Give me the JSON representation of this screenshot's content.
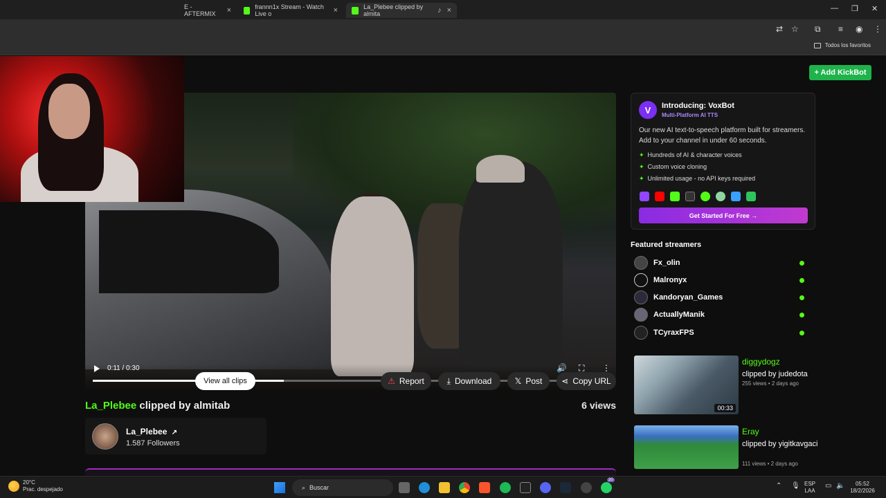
{
  "browser": {
    "tabs": [
      {
        "title": "E - AFTERMIX",
        "active": false
      },
      {
        "title": "frannn1x Stream - Watch Live o",
        "active": false
      },
      {
        "title": "La_Plebee clipped by almita",
        "active": true
      }
    ],
    "bookmarks_folder": "Todos los favoritos"
  },
  "header": {
    "add_bot_label": "+ Add KickBot"
  },
  "player": {
    "time": "0:11 / 0:30",
    "progress": 0.37
  },
  "clip": {
    "channel": "La_Plebee",
    "clipped_by": " clipped by almitab",
    "views": "6 views"
  },
  "channel_card": {
    "name": "La_Plebee",
    "followers": "1.587 Followers",
    "view_all_label": "View all clips"
  },
  "actions": {
    "report": "Report",
    "download": "Download",
    "post": "Post",
    "copy_url": "Copy URL"
  },
  "promo": {
    "title": "Introducing: VoxBot",
    "subtitle": "Multi-Platform AI TTS",
    "description": "Our new AI text-to-speech platform built for streamers. Add to your channel in under 60 seconds.",
    "features": [
      "Hundreds of AI & character voices",
      "Custom voice cloning",
      "Unlimited usage - no API keys required"
    ],
    "cta": "Get Started For Free →"
  },
  "featured": {
    "heading": "Featured streamers",
    "streamers": [
      "Fx_olin",
      "Malronyx",
      "Kandoryan_Games",
      "ActuallyManik",
      "TCyraxFPS"
    ]
  },
  "clips": [
    {
      "channel": "diggydogz",
      "clipped_by": "clipped by judedota",
      "meta": "255 views • 2 days ago",
      "duration": "00:33"
    },
    {
      "channel": "Eray",
      "clipped_by": "clipped by yigitkavgaci",
      "meta": "111 views • 2 days ago",
      "duration": ""
    }
  ],
  "taskbar": {
    "temp": "20°C",
    "weather": "Prac. despejado",
    "search": "Buscar",
    "lang1": "ESP",
    "lang2": "LAA",
    "time": "05:52",
    "date": "18/2/2026",
    "badge": "20"
  },
  "colors": {
    "kick_green": "#53fc18",
    "accent_purple": "#8a2be2"
  }
}
